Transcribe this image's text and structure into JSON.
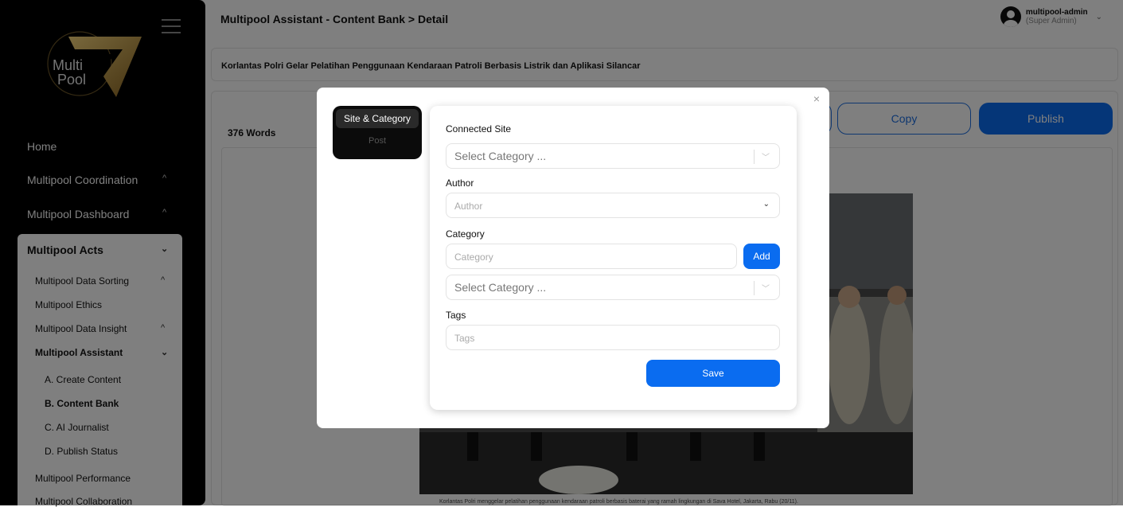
{
  "sidebar": {
    "logo_text_1": "Multi",
    "logo_text_2": "Pool",
    "nav": [
      {
        "label": "Home"
      },
      {
        "label": "Multipool Coordination",
        "chevron": "^"
      },
      {
        "label": "Multipool Dashboard",
        "chevron": "^"
      }
    ],
    "acts": {
      "label": "Multipool Acts",
      "chevron": "⌄",
      "items": [
        {
          "label": "Multipool Data Sorting",
          "chevron": "^"
        },
        {
          "label": "Multipool Ethics"
        },
        {
          "label": "Multipool Data Insight",
          "chevron": "^"
        },
        {
          "label": "Multipool Assistant",
          "chevron": "⌄"
        },
        {
          "label": "A. Create Content"
        },
        {
          "label": "B. Content Bank"
        },
        {
          "label": "C. AI Journalist"
        },
        {
          "label": "D. Publish Status"
        },
        {
          "label": "Multipool Performance"
        },
        {
          "label": "Multipool Collaboration"
        }
      ]
    }
  },
  "header": {
    "breadcrumb": "Multipool Assistant - Content Bank  >  Detail",
    "user_name": "multipool-admin",
    "user_role": "(Super Admin)",
    "user_chevron": "⌄"
  },
  "article": {
    "title": "Korlantas Polri Gelar Pelatihan Penggunaan Kendaraan Patroli Berbasis Listrik dan Aplikasi Silancar",
    "word_count": "376 Words",
    "caption": "Korlantas Polri menggelar pelatihan penggunaan kendaraan patroli berbasis baterai yang ramah lingkungan di Sava Hotel, Jakarta, Rabu (20/11)."
  },
  "actions": {
    "copy_label": "Copy",
    "publish_label": "Publish"
  },
  "modal": {
    "close_glyph": "×",
    "tabs": [
      {
        "label": "Site & Category",
        "active": true
      },
      {
        "label": "Post",
        "active": false
      }
    ],
    "connected_site_label": "Connected Site",
    "connected_site_placeholder": "Select Category ...",
    "author_label": "Author",
    "author_placeholder": "Author",
    "category_label": "Category",
    "category_placeholder": "Category",
    "add_label": "Add",
    "category_select_placeholder": "Select Category ...",
    "tags_label": "Tags",
    "tags_placeholder": "Tags",
    "save_label": "Save"
  },
  "colors": {
    "accent": "#0a6cf0",
    "sidebar_bg": "#000000",
    "logo_gold": "#c9a24a"
  },
  "icons": [
    "hamburger-icon",
    "user-avatar-icon",
    "close-icon",
    "chevron-down-icon",
    "chevron-up-icon"
  ]
}
